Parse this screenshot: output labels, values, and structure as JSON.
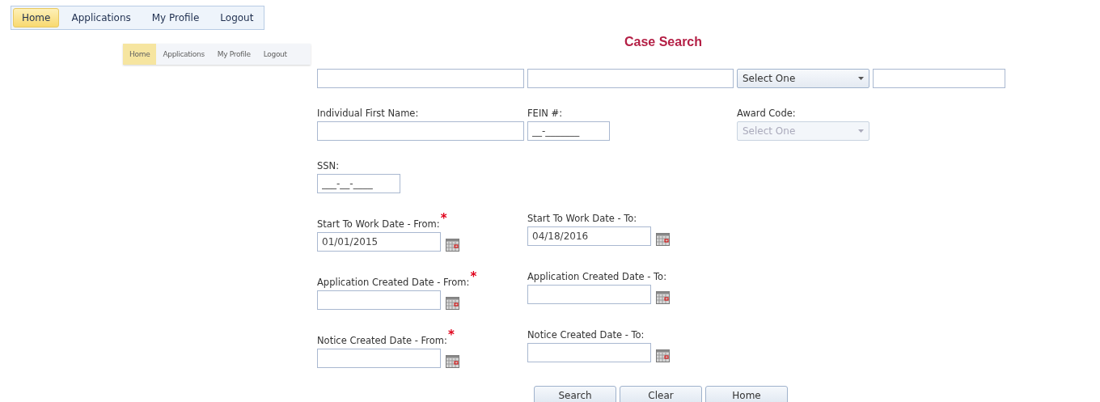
{
  "nav": {
    "items": [
      {
        "label": "Home",
        "selected": true
      },
      {
        "label": "Applications",
        "selected": false
      },
      {
        "label": "My Profile",
        "selected": false
      },
      {
        "label": "Logout",
        "selected": false
      }
    ]
  },
  "ghost_nav": {
    "items": [
      {
        "label": "Home",
        "selected": true
      },
      {
        "label": "Applications",
        "selected": false
      },
      {
        "label": "My Profile",
        "selected": false
      },
      {
        "label": "Logout",
        "selected": false
      }
    ]
  },
  "title": "Case Search",
  "form": {
    "rows": [
      {
        "fields": [
          {
            "kind": "text"
          },
          {
            "kind": "text"
          },
          {
            "kind": "select",
            "value": "Select One",
            "disabled": false
          },
          {
            "kind": "text"
          }
        ]
      },
      {
        "fields": [
          {
            "kind": "text",
            "label": "Individual First Name:"
          },
          {
            "kind": "masked",
            "label": "FEIN #:",
            "value": "__-_______"
          },
          {
            "kind": "select",
            "label": "Award Code:",
            "value": "Select One",
            "disabled": true
          }
        ]
      },
      {
        "fields": [
          {
            "kind": "masked",
            "label": "SSN:",
            "value": "___-__-____"
          }
        ]
      },
      {
        "fields": [
          {
            "kind": "date",
            "label": "Start To Work Date - From:",
            "required_mark": "*",
            "value": "01/01/2015"
          },
          {
            "kind": "date",
            "label": "Start To Work Date - To:",
            "value": "04/18/2016"
          }
        ]
      },
      {
        "fields": [
          {
            "kind": "date",
            "label": "Application Created Date - From:",
            "required_mark": "*"
          },
          {
            "kind": "date",
            "label": "Application Created Date - To:"
          }
        ]
      },
      {
        "fields": [
          {
            "kind": "date",
            "label": "Notice Created Date - From:",
            "required_mark": "*"
          },
          {
            "kind": "date",
            "label": "Notice Created Date - To:"
          }
        ]
      }
    ]
  },
  "buttons": [
    "Search",
    "Clear",
    "Home"
  ]
}
